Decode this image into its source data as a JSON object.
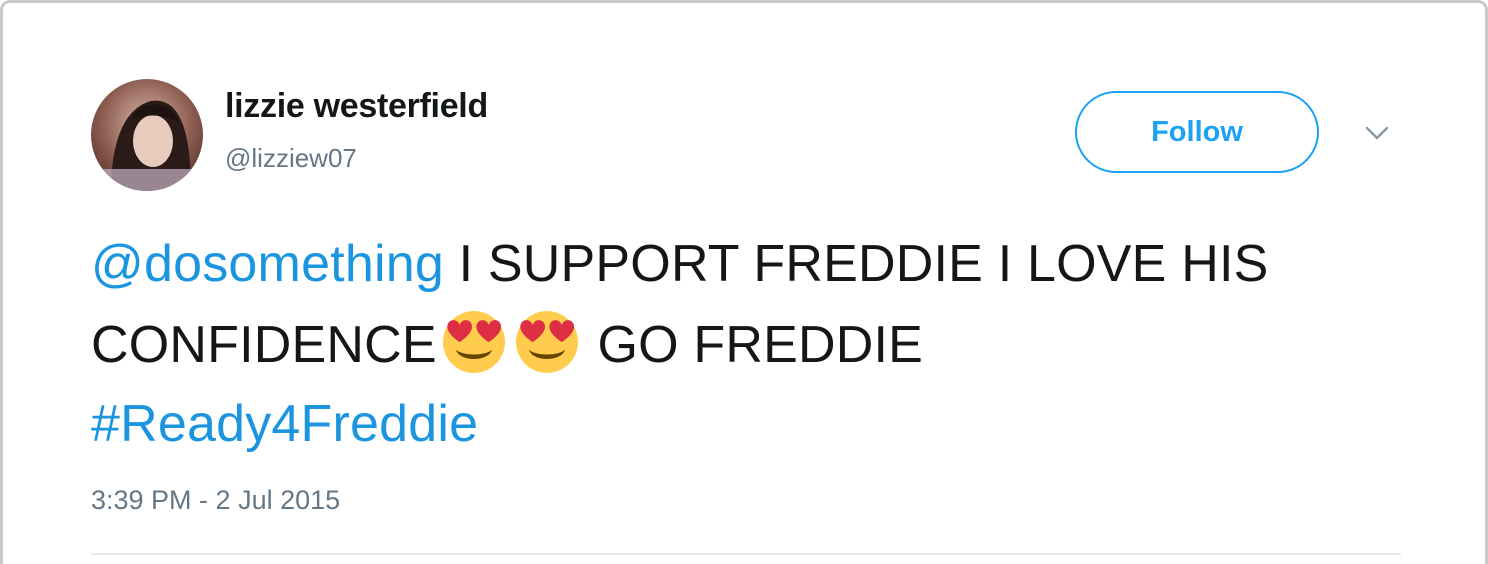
{
  "user": {
    "display_name": "lizzie westerfield",
    "handle": "@lizziew07",
    "avatar_icon": "profile-photo"
  },
  "follow_button": {
    "label": "Follow"
  },
  "menu": {
    "icon": "chevron-down-icon"
  },
  "tweet": {
    "mention": "@dosomething",
    "text_part1": " I SUPPORT FREDDIE I LOVE HIS CONFIDENCE",
    "emoji": [
      "heart-eyes-emoji",
      "heart-eyes-emoji"
    ],
    "text_part2": " GO FREDDIE ",
    "hashtag": "#Ready4Freddie",
    "timestamp": "3:39 PM - 2 Jul 2015"
  },
  "colors": {
    "link": "#1b95e0",
    "follow_accent": "#1da1f2",
    "text": "#14171a",
    "muted": "#657786"
  }
}
